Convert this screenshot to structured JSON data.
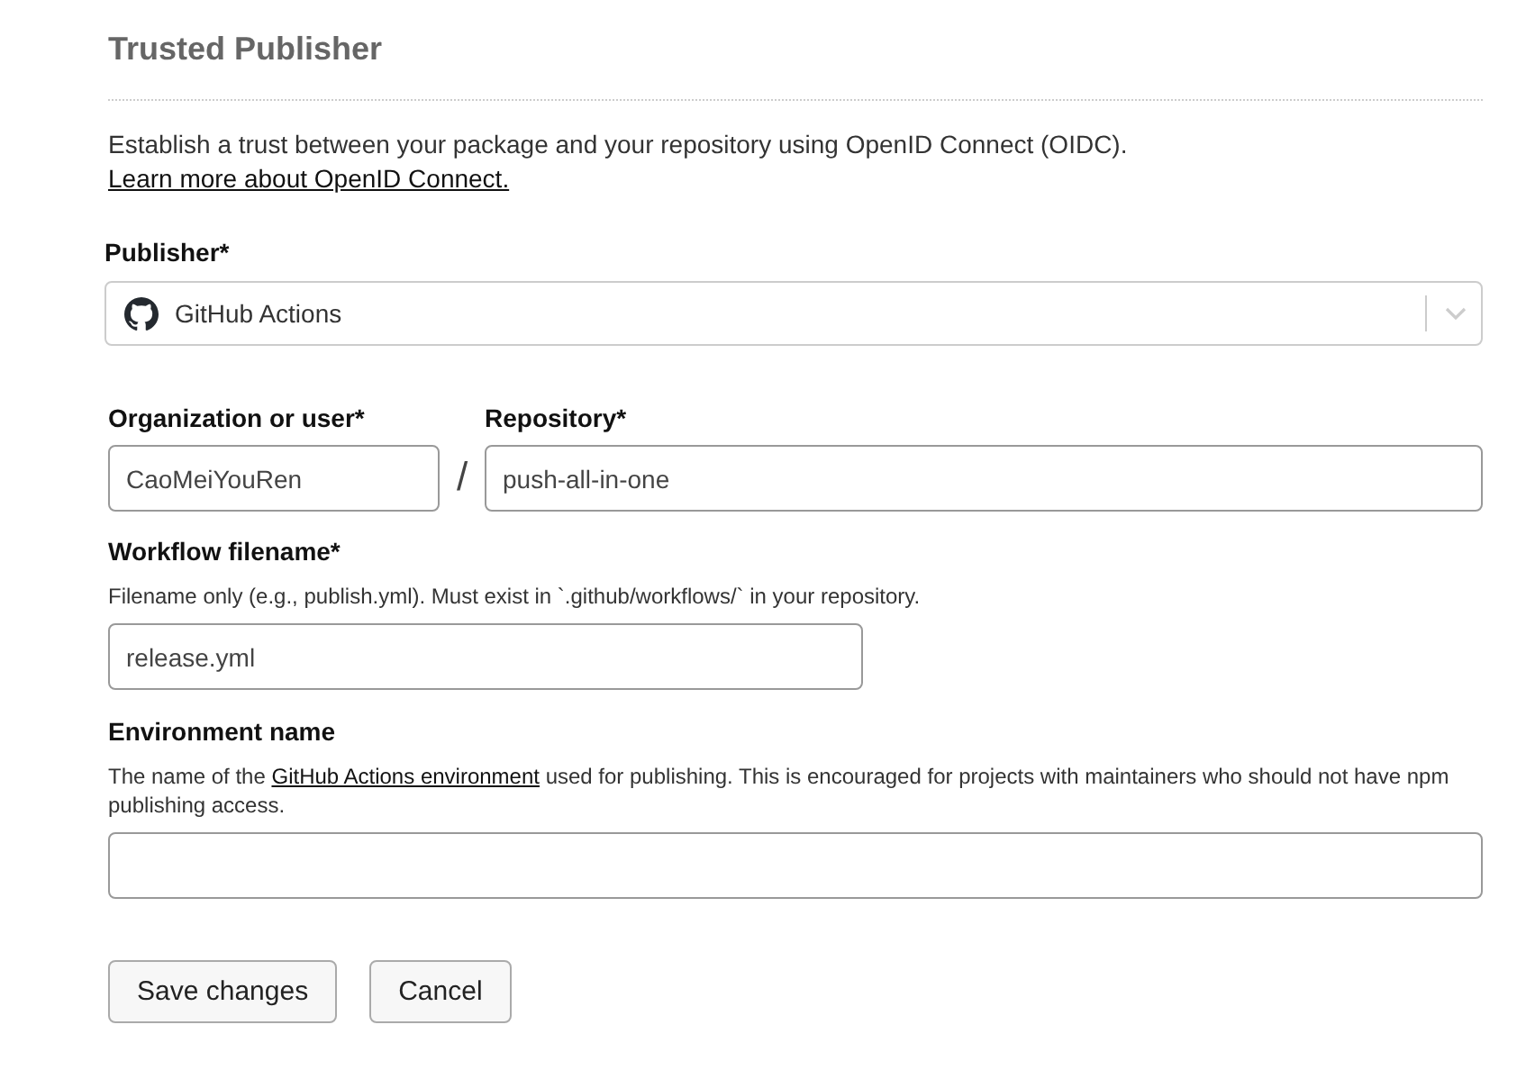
{
  "section": {
    "title": "Trusted Publisher"
  },
  "intro": {
    "text": "Establish a trust between your package and your repository using OpenID Connect (OIDC).",
    "link": "Learn more about OpenID Connect."
  },
  "publisher": {
    "label": "Publisher*",
    "value": "GitHub Actions"
  },
  "organization": {
    "label": "Organization or user*",
    "value": "CaoMeiYouRen"
  },
  "separator": "/",
  "repository": {
    "label": "Repository*",
    "value": "push-all-in-one"
  },
  "workflow": {
    "label": "Workflow filename*",
    "help": "Filename only (e.g., publish.yml). Must exist in `.github/workflows/` in your repository.",
    "value": "release.yml"
  },
  "environment": {
    "label": "Environment name",
    "help_before": "The name of the ",
    "help_link": "GitHub Actions environment",
    "help_after": " used for publishing. This is encouraged for projects with maintainers who should not have npm publishing access."
  },
  "buttons": [
    "Save changes",
    "Cancel"
  ]
}
